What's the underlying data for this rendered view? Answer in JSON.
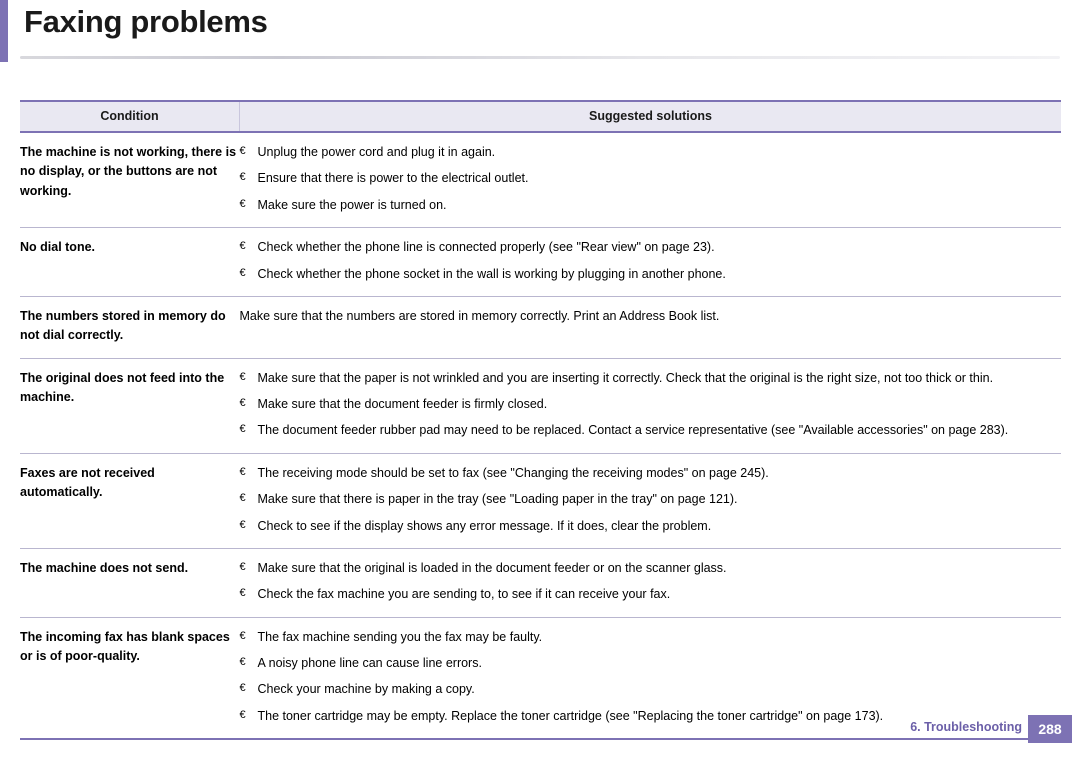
{
  "page": {
    "title": "Faxing problems",
    "footer_section": "6.  Troubleshooting",
    "footer_page_number": "288"
  },
  "table": {
    "headers": {
      "condition": "Condition",
      "solutions": "Suggested solutions"
    },
    "rows": [
      {
        "condition": "The machine is not working, there is no display, or the buttons are not working.",
        "solutions": [
          "Unplug the power cord and plug it in again.",
          "Ensure that there is power to the electrical outlet.",
          "Make sure the power is turned on."
        ]
      },
      {
        "condition": "No dial tone.",
        "solutions": [
          "Check whether the phone line is connected properly (see \"Rear view\" on page 23).",
          "Check whether the phone socket in the wall is working by plugging in another phone."
        ]
      },
      {
        "condition": "The numbers stored in memory do not dial correctly.",
        "solutions": [
          "Make sure that the numbers are stored in memory correctly. Print an Address Book list."
        ]
      },
      {
        "condition": "The original does not feed into the machine.",
        "solutions": [
          "Make sure that the paper is not wrinkled and you are inserting it correctly. Check that the original is the right size, not too thick or thin.",
          "Make sure that the document feeder is firmly closed.",
          "The document feeder rubber pad may need to be replaced. Contact a service representative (see \"Available accessories\" on page 283).",
          ""
        ]
      },
      {
        "condition": "Faxes are not received automatically.",
        "solutions": [
          "The receiving mode should be set to fax (see \"Changing the receiving modes\" on page 245).",
          "Make sure that there is paper in the tray (see \"Loading paper in the tray\" on page 121).",
          "Check to see if the display shows any error message. If it does, clear the problem."
        ]
      },
      {
        "condition": "The machine does not send.",
        "solutions": [
          "Make sure that the original is loaded in the document feeder or on the scanner glass.",
          "Check the fax machine you are sending to, to see if it can receive your fax."
        ]
      },
      {
        "condition": "The incoming fax has blank spaces or is of poor-quality.",
        "solutions": [
          "The fax machine sending you the fax may be faulty.",
          "A noisy phone line can cause line errors.",
          "Check your machine by making a copy.",
          "The toner cartridge may be empty. Replace the toner cartridge (see \"Replacing the toner cartridge\" on page 173)."
        ]
      }
    ]
  },
  "colors": {
    "accent": "#7d72b4",
    "header_bg": "#e9e8f2",
    "rule": "#b9b6cf"
  }
}
